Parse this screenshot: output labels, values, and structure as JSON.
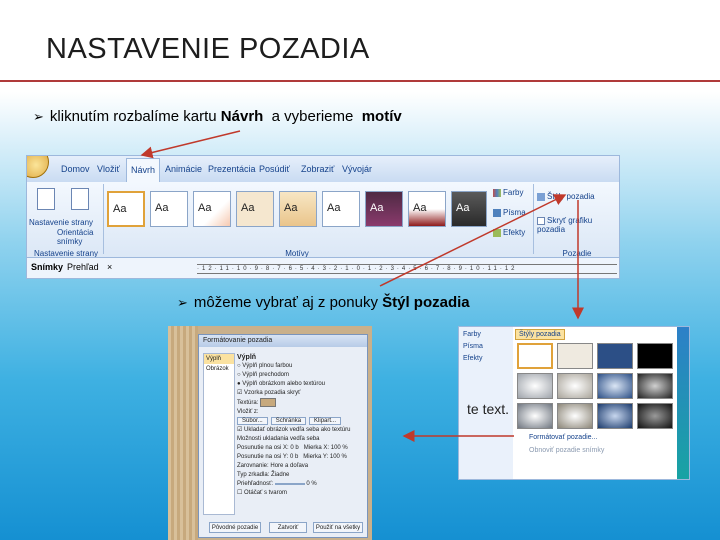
{
  "slide": {
    "title": "NASTAVENIE POZADIA",
    "bullet1": {
      "text": "kliknutím rozbalíme kartu ",
      "bold1": "Návrh",
      "mid": "  a vyberieme  ",
      "bold2": "motív"
    },
    "bullet2": {
      "text": "môžeme vybrať aj z ponuky ",
      "bold": "Štýl pozadia"
    }
  },
  "ribbon": {
    "tabs": [
      "Domov",
      "Vložiť",
      "Návrh",
      "Animácie",
      "Prezentácia",
      "Posúdiť",
      "Zobraziť",
      "Vývojár"
    ],
    "active_tab": "Návrh",
    "group_setup_label": "Nastavenie strany",
    "setup_buttons": [
      "Nastavenie strany",
      "Orientácia snímky"
    ],
    "group_themes_label": "Motívy",
    "theme_sample": "Aa",
    "theme_options": [
      "Farby",
      "Písma",
      "Efekty"
    ],
    "group_background_label": "Pozadie",
    "background_options": [
      "Štýly pozadia",
      "Skryť grafiku pozadia"
    ],
    "pane_tabs": [
      "Snímky",
      "Prehľad"
    ],
    "pane_close": "×",
    "ruler": "·12·11·10·9·8·7·6·5·4·3·2·1·0·1·2·3·4·5·6·7·8·9·10·11·12"
  },
  "dialog": {
    "title": "Formátovanie pozadia",
    "side": [
      "Výplň",
      "Obrázok"
    ],
    "section": "Výplň",
    "options": [
      "Výplň plnou farbou",
      "Výplň prechodom",
      "Výplň obrázkom alebo textúrou",
      "Vzorka pozadia skryť"
    ],
    "texture_label": "Textúra:",
    "insert_label": "Vložiť z:",
    "insert_buttons": [
      "Súbor...",
      "Schránka",
      "Klipart..."
    ],
    "tile_label": "Ukladať obrázok vedľa seba ako textúru",
    "offsets_header": "Možnosti ukladania vedľa seba",
    "offset_x_label": "Posunutie na osi X:",
    "offset_x": "0 b",
    "offset_y_label": "Posunutie na osi Y:",
    "offset_y": "0 b",
    "scale_x_label": "Mierka X:",
    "scale_x": "100 %",
    "scale_y_label": "Mierka Y:",
    "scale_y": "100 %",
    "align_label": "Zarovnanie:",
    "align": "Hore a doľava",
    "mirror_label": "Typ zrkadla:",
    "mirror": "Žiadne",
    "transparency_label": "Priehľadnosť:",
    "transparency": "0 %",
    "rotate_label": "Otáčať s tvarom",
    "buttons": [
      "Pôvodné pozadie",
      "Zatvoriť",
      "Použiť na všetky"
    ]
  },
  "gallery": {
    "header": "Štýly pozadia",
    "theme_options": [
      "Farby",
      "Písma",
      "Efekty"
    ],
    "slide_text": "te text.",
    "menu": [
      "Formátovať pozadie...",
      "Obnoviť pozadie snímky"
    ]
  }
}
